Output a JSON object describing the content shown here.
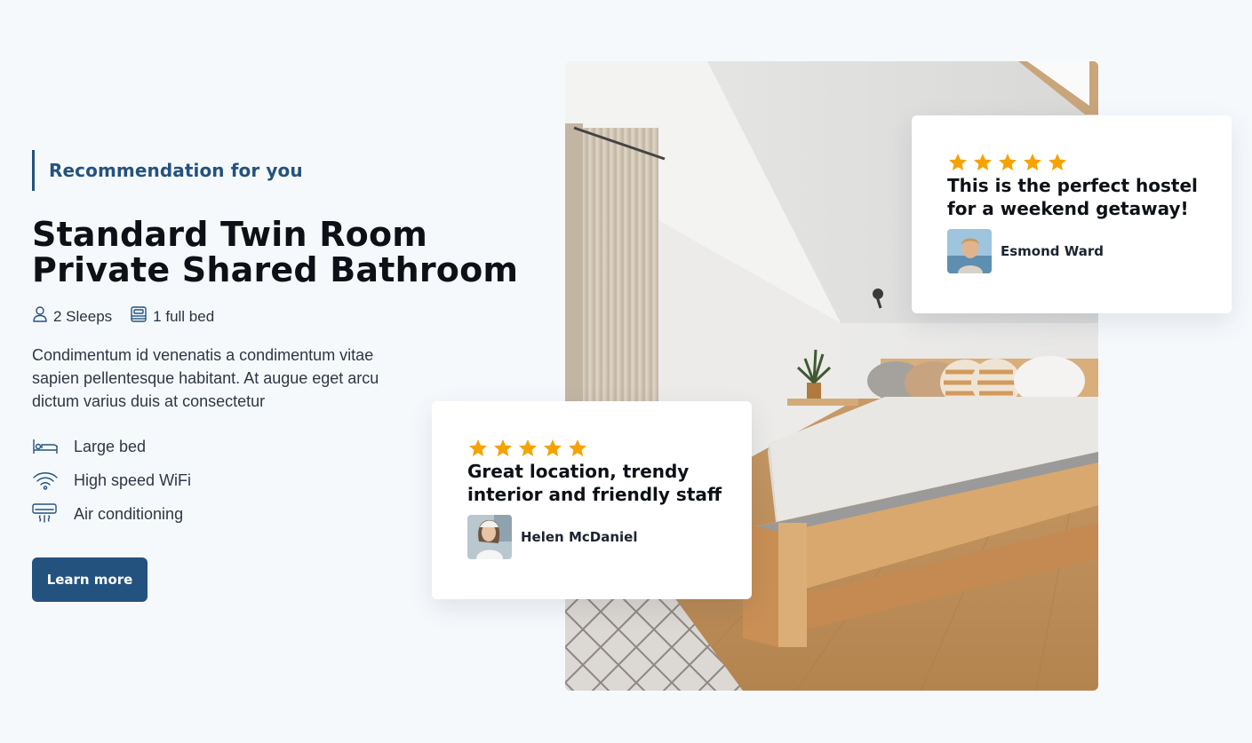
{
  "intro": {
    "eyebrow": "Recommendation for you",
    "title_line1": "Standard Twin Room",
    "title_line2": "Private Shared Bathroom"
  },
  "specs": [
    {
      "icon": "person-icon",
      "label": "2 Sleeps"
    },
    {
      "icon": "bed-icon",
      "label": "1 full bed"
    }
  ],
  "description": "Condimentum id venenatis a condimentum vitae sapien pellentesque habitant. At augue eget arcu dictum varius duis at consectetur",
  "amenities": [
    {
      "icon": "bed-icon",
      "label": "Large bed"
    },
    {
      "icon": "wifi-icon",
      "label": "High speed WiFi"
    },
    {
      "icon": "air-conditioner-icon",
      "label": "Air conditioning"
    }
  ],
  "cta": {
    "label": "Learn more"
  },
  "reviews": [
    {
      "rating": 5,
      "quote": "This is the perfect hostel for a weekend getaway!",
      "author": "Esmond Ward"
    },
    {
      "rating": 5,
      "quote": "Great location, trendy interior and friendly staff",
      "author": "Helen McDaniel"
    }
  ],
  "colors": {
    "accent": "#23527f",
    "star": "#f5a300",
    "background": "#f6f9fc"
  }
}
